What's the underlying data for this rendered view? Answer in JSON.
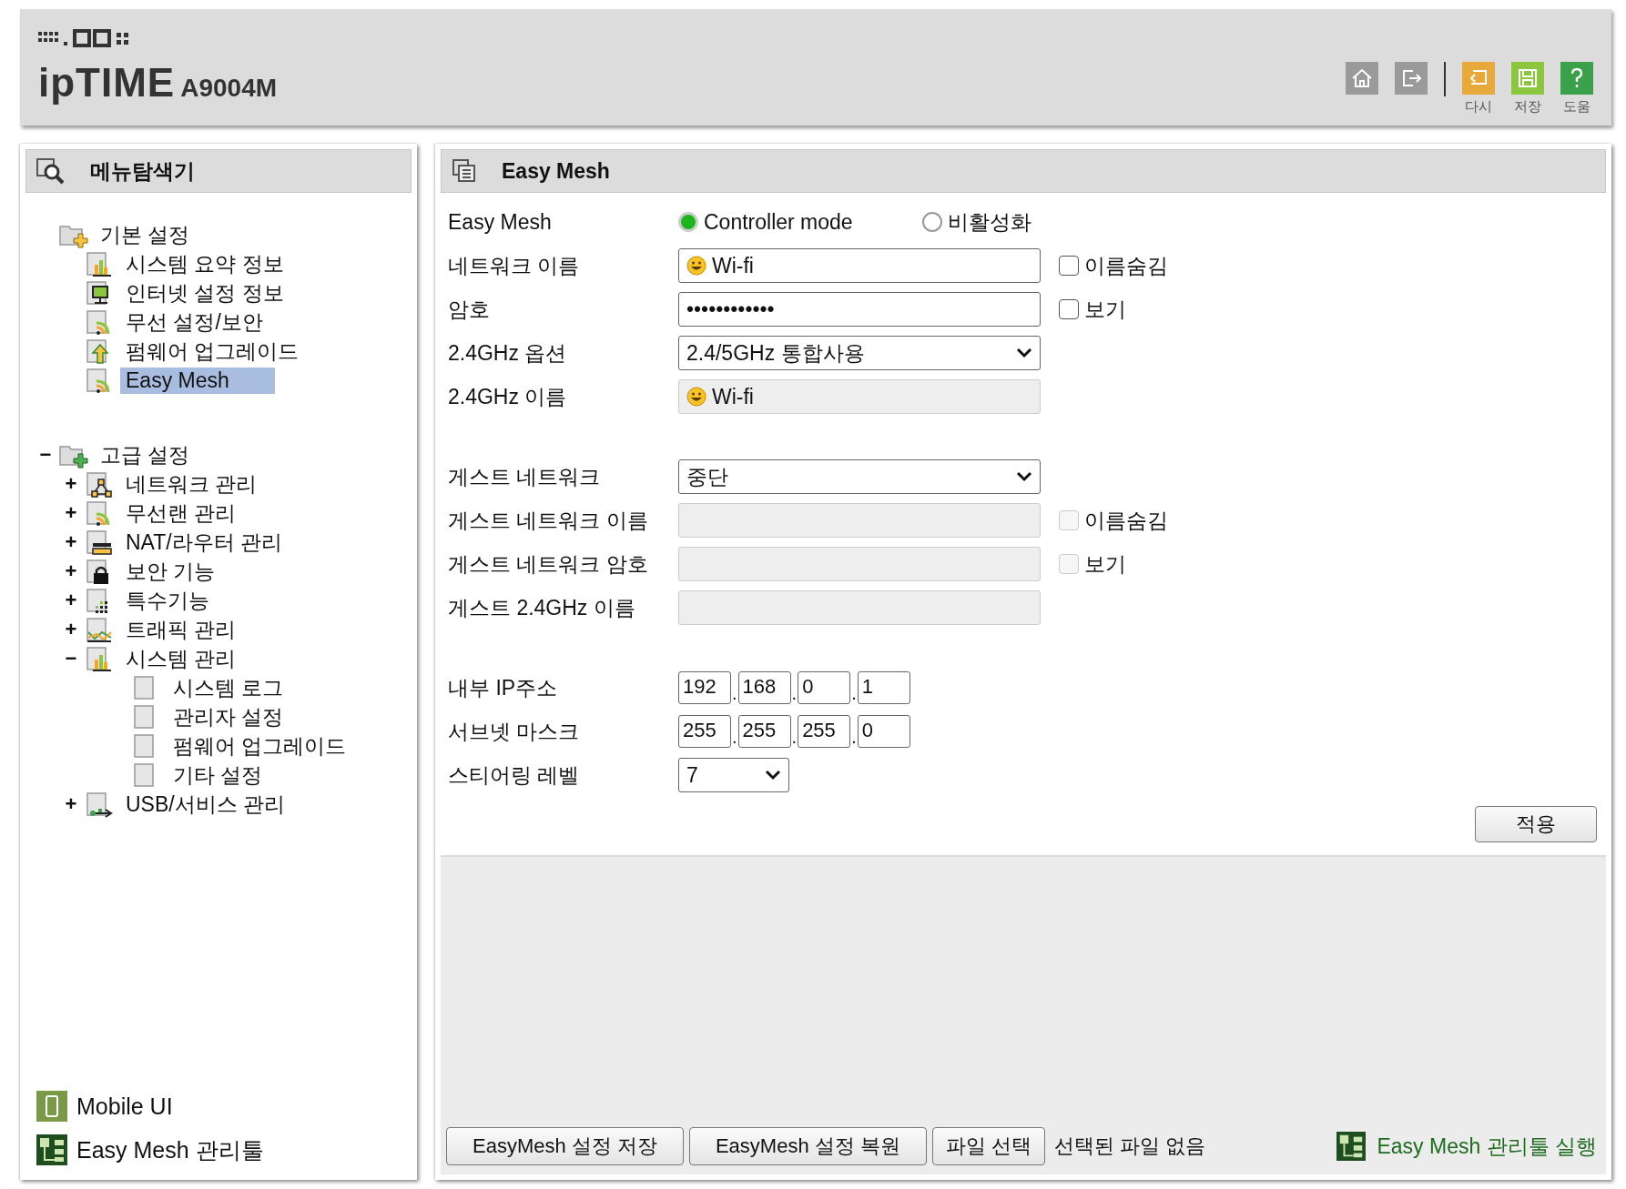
{
  "header": {
    "logo": "ipTIME",
    "model": "A9004M",
    "tools": [
      {
        "kind": "home"
      },
      {
        "kind": "logout"
      },
      {
        "kind": "reload",
        "label": "다시"
      },
      {
        "kind": "save",
        "label": "저장"
      },
      {
        "kind": "help",
        "label": "도움"
      }
    ]
  },
  "sidebar": {
    "title": "메뉴탐색기",
    "tree": [
      {
        "label": "기본 설정",
        "kind": "folder-star",
        "children": [
          {
            "label": "시스템 요약 정보",
            "kind": "chart",
            "selected": false
          },
          {
            "label": "인터넷 설정 정보",
            "kind": "monitor",
            "selected": false
          },
          {
            "label": "무선 설정/보안",
            "kind": "wifi",
            "selected": false
          },
          {
            "label": "펌웨어 업그레이드",
            "kind": "upload",
            "selected": false
          },
          {
            "label": "Easy Mesh",
            "kind": "wifi",
            "selected": true
          }
        ]
      },
      {
        "label": "고급 설정",
        "kind": "folder-plus",
        "toggle": "−",
        "children": [
          {
            "label": "네트워크 관리",
            "kind": "network",
            "toggle": "+",
            "selected": false
          },
          {
            "label": "무선랜 관리",
            "kind": "wifi",
            "toggle": "+",
            "selected": false
          },
          {
            "label": "NAT/라우터 관리",
            "kind": "nat",
            "toggle": "+",
            "selected": false
          },
          {
            "label": "보안 기능",
            "kind": "lock",
            "toggle": "+",
            "selected": false
          },
          {
            "label": "특수기능",
            "kind": "grid",
            "toggle": "+",
            "selected": false
          },
          {
            "label": "트래픽 관리",
            "kind": "traffic",
            "toggle": "+",
            "selected": false
          },
          {
            "label": "시스템 관리",
            "kind": "chart",
            "toggle": "−",
            "selected": false,
            "children": [
              {
                "label": "시스템 로그",
                "kind": "page",
                "selected": false
              },
              {
                "label": "관리자 설정",
                "kind": "page",
                "selected": false
              },
              {
                "label": "펌웨어 업그레이드",
                "kind": "page",
                "selected": false
              },
              {
                "label": "기타 설정",
                "kind": "page",
                "selected": false
              }
            ]
          },
          {
            "label": "USB/서비스 관리",
            "kind": "usb",
            "toggle": "+",
            "selected": false
          }
        ]
      }
    ],
    "links": [
      {
        "kind": "mobile",
        "label": "Mobile UI"
      },
      {
        "kind": "mesh",
        "label": "Easy Mesh 관리툴"
      }
    ]
  },
  "panel": {
    "title": "Easy Mesh",
    "groups": [
      [
        {
          "kind": "radio",
          "label": "Easy Mesh",
          "options": [
            {
              "label": "Controller mode",
              "selected": true
            },
            {
              "label": "비활성화",
              "selected": false
            }
          ]
        },
        {
          "kind": "text",
          "label": "네트워크 이름",
          "value": "Wi-fi",
          "smiley": true,
          "disabled": false,
          "check": {
            "label": "이름숨김",
            "checked": false,
            "disabled": false
          }
        },
        {
          "kind": "text",
          "label": "암호",
          "value": "••••••••••••",
          "disabled": false,
          "check": {
            "label": "보기",
            "checked": false,
            "disabled": false
          }
        },
        {
          "kind": "select",
          "label": "2.4GHz 옵션",
          "value": "2.4/5GHz 통합사용"
        },
        {
          "kind": "text",
          "label": "2.4GHz 이름",
          "value": "Wi-fi",
          "smiley": true,
          "disabled": true
        }
      ],
      [
        {
          "kind": "select",
          "label": "게스트 네트워크",
          "value": "중단"
        },
        {
          "kind": "text",
          "label": "게스트 네트워크 이름",
          "disabled": true,
          "check": {
            "label": "이름숨김",
            "checked": false,
            "disabled": true
          }
        },
        {
          "kind": "text",
          "label": "게스트 네트워크 암호",
          "disabled": true,
          "check": {
            "label": "보기",
            "checked": false,
            "disabled": true
          }
        },
        {
          "kind": "text",
          "label": "게스트 2.4GHz 이름",
          "disabled": true
        }
      ],
      [
        {
          "kind": "ip",
          "label": "내부 IP주소",
          "parts": [
            "192",
            "168",
            "0",
            "1"
          ],
          "separators": [
            ".",
            ".",
            "."
          ]
        },
        {
          "kind": "ip",
          "label": "서브넷 마스크",
          "parts": [
            "255",
            "255",
            "255",
            "0"
          ],
          "separators": [
            ".",
            ".",
            "."
          ]
        },
        {
          "kind": "small-select",
          "label": "스티어링 레벨",
          "value": "7"
        }
      ]
    ],
    "apply": "적용",
    "footer": {
      "buttons": [
        "EasyMesh 설정 저장",
        "EasyMesh 설정 복원"
      ],
      "file_button": "파일 선택",
      "file_status": "선택된 파일 없음",
      "tool_link": "Easy Mesh 관리툴 실행"
    }
  }
}
